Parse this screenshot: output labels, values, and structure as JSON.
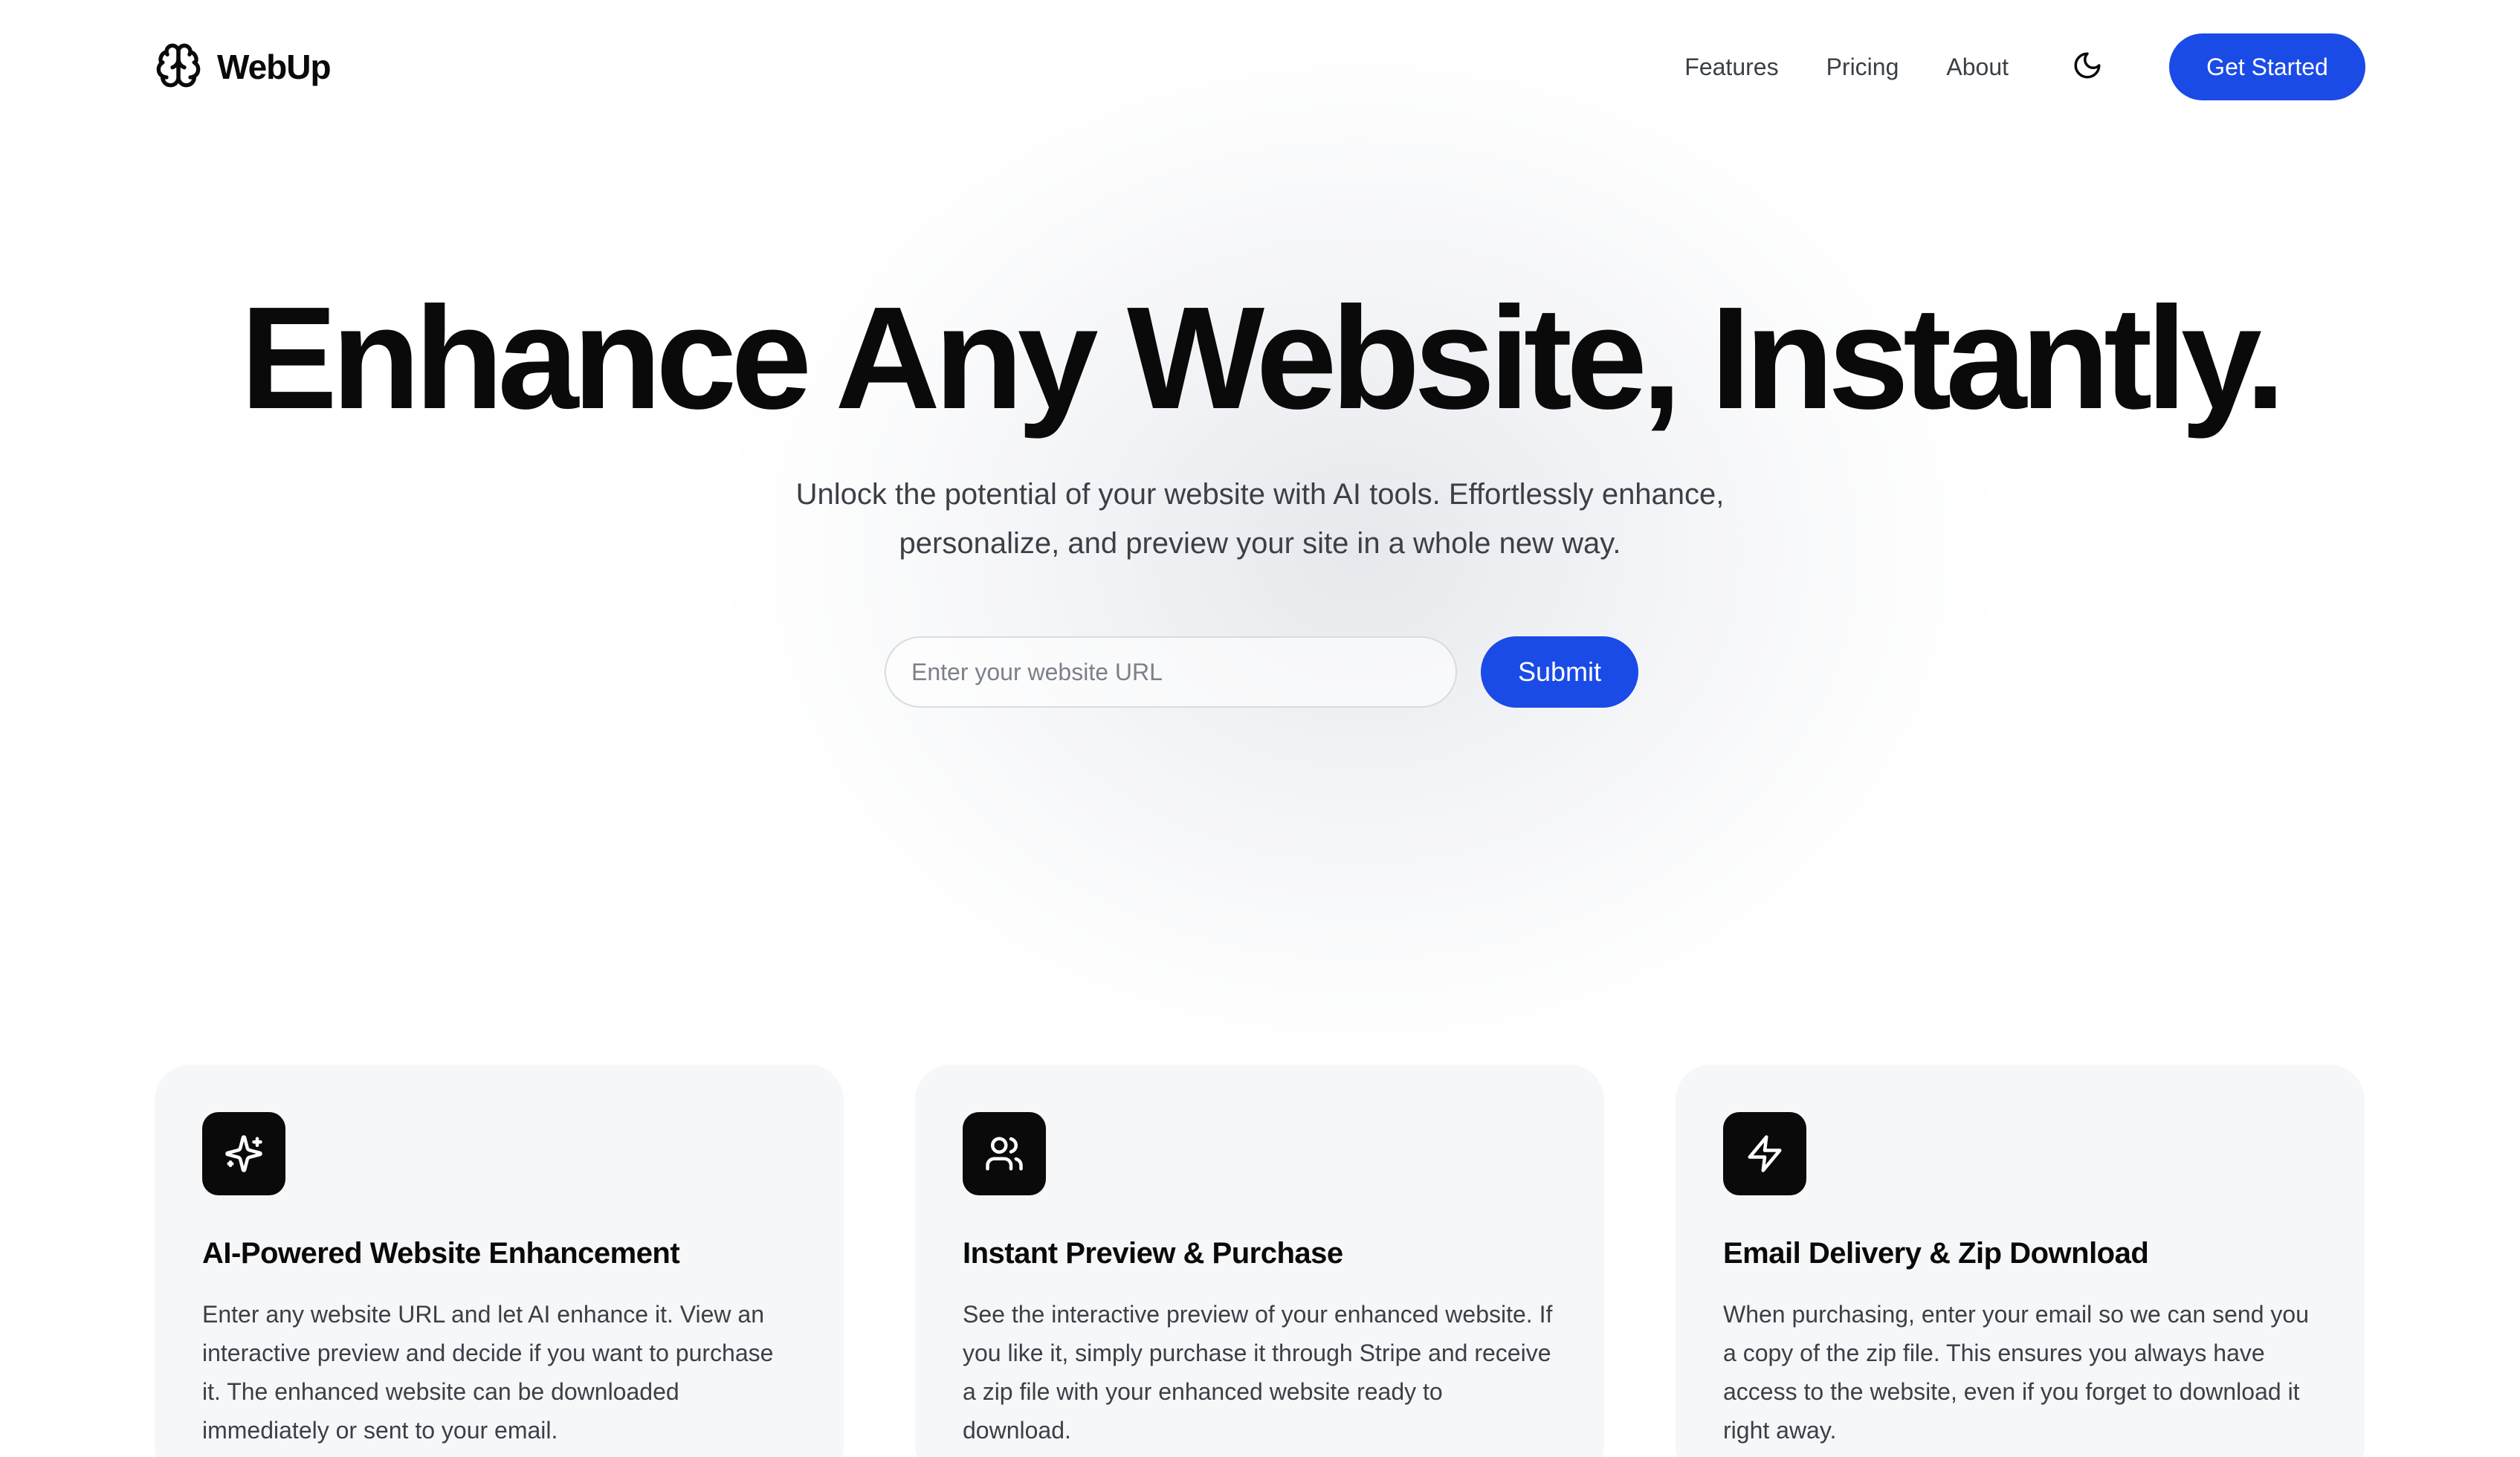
{
  "brand": {
    "name": "WebUp",
    "logo_icon": "brain-icon"
  },
  "nav": {
    "links": [
      "Features",
      "Pricing",
      "About"
    ],
    "theme_toggle_icon": "moon-icon",
    "cta_label": "Get Started"
  },
  "hero": {
    "title": "Enhance Any Website, Instantly.",
    "subtitle": "Unlock the potential of your website with AI tools. Effortlessly enhance, personalize, and preview your site in a whole new way.",
    "input_placeholder": "Enter your website URL",
    "submit_label": "Submit"
  },
  "features": [
    {
      "icon": "sparkles-icon",
      "title": "AI-Powered Website Enhancement",
      "text": "Enter any website URL and let AI enhance it. View an interactive preview and decide if you want to purchase it. The enhanced website can be downloaded immediately or sent to your email."
    },
    {
      "icon": "users-icon",
      "title": "Instant Preview & Purchase",
      "text": "See the interactive preview of your enhanced website. If you like it, simply purchase it through Stripe and receive a zip file with your enhanced website ready to download."
    },
    {
      "icon": "lightning-icon",
      "title": "Email Delivery & Zip Download",
      "text": "When purchasing, enter your email so we can send you a copy of the zip file. This ensures you always have access to the website, even if you forget to download it right away."
    }
  ],
  "colors": {
    "accent": "#1a4be6",
    "text": "#0a0a0a",
    "muted_text": "#3b3f47",
    "card_bg": "#f6f7f9",
    "icon_tile_bg": "#0a0a0a"
  }
}
